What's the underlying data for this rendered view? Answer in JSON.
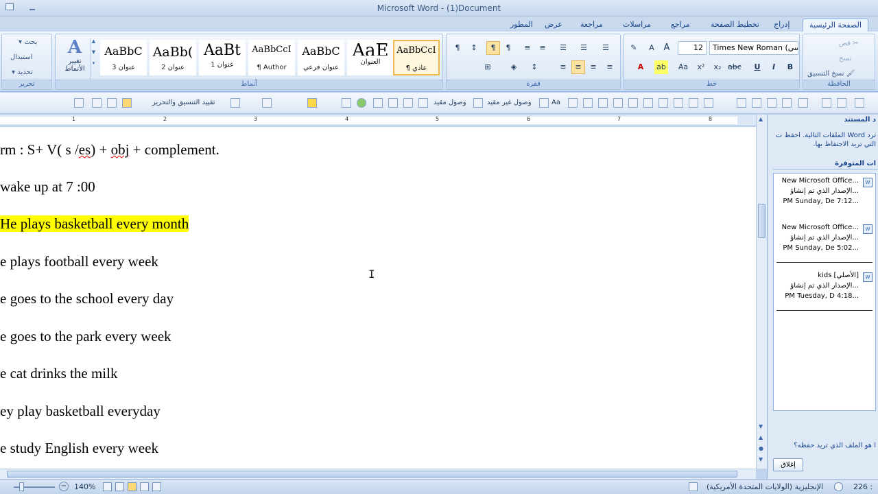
{
  "window": {
    "title": "Microsoft Word - (1)Document"
  },
  "tabs": [
    "الصفحة الرئيسية",
    "إدراج",
    "تخطيط الصفحة",
    "مراجع",
    "مراسلات",
    "مراجعة",
    "عرض",
    "المطور"
  ],
  "ribbon": {
    "editing": {
      "find": "بحث",
      "replace": "استبدال",
      "select": "تحديد",
      "label": "تحرير"
    },
    "change_styles": "تغيير الأنماط",
    "styles_label": "أنماط",
    "styles": [
      {
        "sample": "AaBbC",
        "name": "عنوان 3"
      },
      {
        "sample": "AaBb(",
        "name": "عنوان 2"
      },
      {
        "sample": "AaBt",
        "name": "عنوان 1"
      },
      {
        "sample": "AaBbCcI",
        "name": "¶ Author"
      },
      {
        "sample": "AaBbC",
        "name": "عنوان فرعي"
      },
      {
        "sample": "AaE",
        "name": "العنوان"
      },
      {
        "sample": "AaBbCcI",
        "name": "¶ عادي"
      }
    ],
    "paragraph_label": "فقرة",
    "font_label": "خط",
    "font_name": "Times New Roman (اسي",
    "font_size": "12",
    "clipboard": {
      "cut": "قص",
      "copy": "نسخ",
      "format_painter": "نسخ التنسيق",
      "label": "الحافظة"
    }
  },
  "toolbar": {
    "restrict": "تقييد التنسيق والتحرير",
    "reliable": "وصول مقيد",
    "unrestricted": "وصول غير مقيد"
  },
  "ruler_numbers": [
    "1",
    "2",
    "3",
    "4",
    "5",
    "6",
    "7",
    "8"
  ],
  "document": {
    "lines": [
      {
        "before": "rm : S+ V( s /",
        "spell": "es",
        "after": ") + ",
        "spell2": "obj",
        "after2": " + complement."
      },
      {
        "text": "wake up at 7 :00"
      },
      {
        "text": "He plays basketball every month",
        "highlight": true
      },
      {
        "text": "e plays football every week"
      },
      {
        "text": "e goes to the school every day"
      },
      {
        "text": "e goes to the park every week"
      },
      {
        "text": "e cat drinks the milk"
      },
      {
        "text": "ey play basketball everyday"
      },
      {
        "text": "e study English every week"
      }
    ]
  },
  "pane": {
    "title": "د المستند",
    "description": "ترد Word الملفات التالية. احفظ ت التي تريد الاحتفاظ بها.",
    "available": "ات المتوفرة",
    "files": [
      {
        "name": "New Microsoft Office...",
        "sub": "الإصدار الذي تم إنشاؤ...",
        "date": "PM Sunday, De 7:12..."
      },
      {
        "name": "New Microsoft Office...",
        "sub": "الإصدار الذي تم إنشاؤ...",
        "date": "PM Sunday, De 5:02..."
      },
      {
        "name": "kids  [الأصلي]",
        "sub": "الإصدار الذي تم إنشاؤ...",
        "date": "PM Tuesday, D 4:18..."
      }
    ],
    "question": "ا هو الملف الذي تريد حفظه؟",
    "close": "إغلاق"
  },
  "status": {
    "zoom": "140%",
    "language": "الإنجليزية (الولايات المتحدة الأمريكية)",
    "words": "226 :"
  }
}
